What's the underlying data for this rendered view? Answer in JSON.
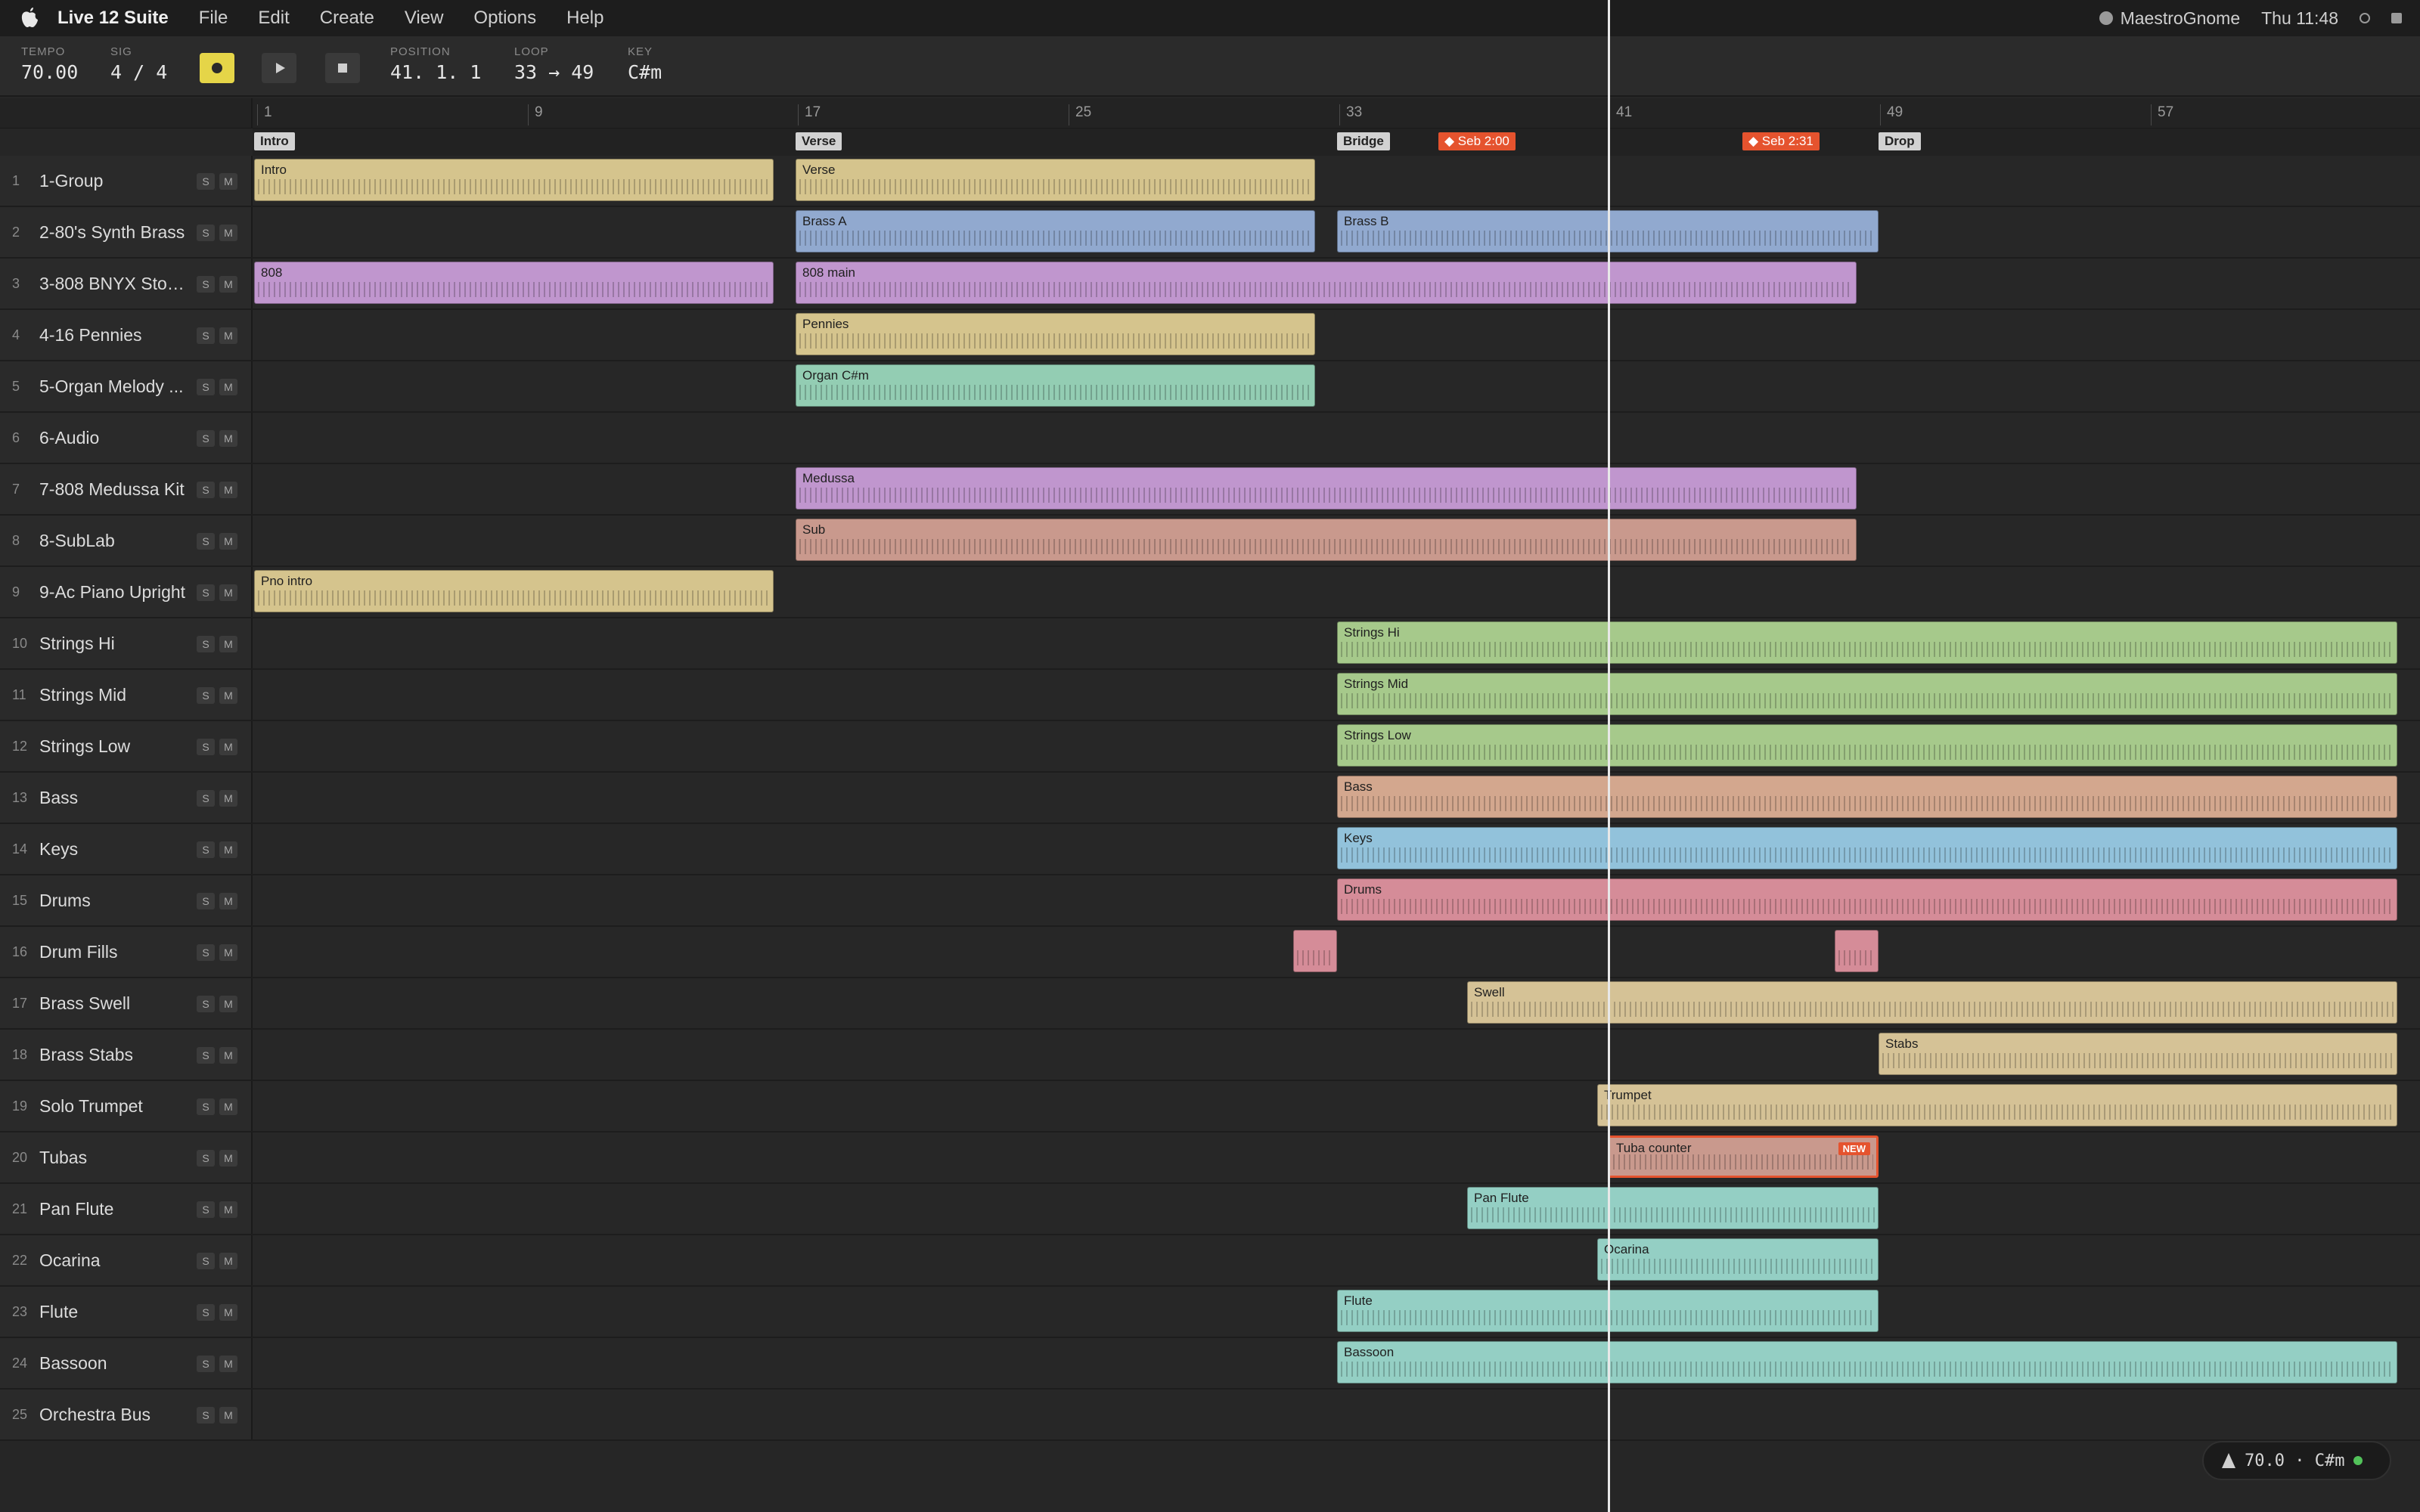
{
  "menubar": {
    "app_name": "Live 12 Suite",
    "items": [
      "File",
      "Edit",
      "Create",
      "View",
      "Options",
      "Help"
    ],
    "user": "MaestroGnome",
    "clock": "Thu 11:48"
  },
  "transport": {
    "tempo_label": "TEMPO",
    "tempo": "70.00",
    "sig_label": "SIG",
    "sig": "4 / 4",
    "position_label": "POSITION",
    "position": "41. 1. 1",
    "loop_label": "LOOP",
    "loop": "33 → 49",
    "key_label": "KEY",
    "key": "C#m"
  },
  "ruler": [
    "1",
    "9",
    "17",
    "25",
    "33",
    "41",
    "49",
    "57"
  ],
  "locators": {
    "sections": [
      "Intro",
      "Verse",
      "Bridge",
      "Drop"
    ],
    "comments": [
      "◆ Seb 2:00",
      "◆ Seb 2:31"
    ]
  },
  "colors": {
    "yellow": "#d5c48d",
    "blue": "#91a9cf",
    "purple": "#c096ce",
    "teal": "#93cdb3",
    "salmon": "#c9998d",
    "green": "#a6c98b",
    "peach": "#d3a78e",
    "sky": "#92c2db",
    "pink": "#d58c98",
    "tan": "#d5c296",
    "aqua": "#94cfc4",
    "accent": "#e5532e"
  },
  "tracks": [
    {
      "num": "1",
      "name": "1-Group",
      "clips": [
        {
          "name": "Intro"
        },
        {
          "name": "Verse"
        }
      ]
    },
    {
      "num": "2",
      "name": "2-80's Synth Brass",
      "clips": [
        {
          "name": "Brass A"
        },
        {
          "name": "Brass B"
        }
      ]
    },
    {
      "num": "3",
      "name": "3-808 BNYX Stop...",
      "clips": [
        {
          "name": "808"
        },
        {
          "name": "808 main"
        }
      ]
    },
    {
      "num": "4",
      "name": "4-16 Pennies",
      "clips": [
        {
          "name": "Pennies"
        }
      ]
    },
    {
      "num": "5",
      "name": "5-Organ Melody ...",
      "clips": [
        {
          "name": "Organ C#m"
        }
      ]
    },
    {
      "num": "6",
      "name": "6-Audio",
      "clips": []
    },
    {
      "num": "7",
      "name": "7-808 Medussa Kit",
      "clips": [
        {
          "name": "Medussa"
        }
      ]
    },
    {
      "num": "8",
      "name": "8-SubLab",
      "clips": [
        {
          "name": "Sub"
        }
      ]
    },
    {
      "num": "9",
      "name": "9-Ac Piano Upright",
      "clips": [
        {
          "name": "Pno intro"
        }
      ]
    },
    {
      "num": "10",
      "name": "Strings Hi",
      "clips": [
        {
          "name": "Strings Hi"
        }
      ]
    },
    {
      "num": "11",
      "name": "Strings Mid",
      "clips": [
        {
          "name": "Strings Mid"
        }
      ]
    },
    {
      "num": "12",
      "name": "Strings Low",
      "clips": [
        {
          "name": "Strings Low"
        }
      ]
    },
    {
      "num": "13",
      "name": "Bass",
      "clips": [
        {
          "name": "Bass"
        }
      ]
    },
    {
      "num": "14",
      "name": "Keys",
      "clips": [
        {
          "name": "Keys"
        }
      ]
    },
    {
      "num": "15",
      "name": "Drums",
      "clips": [
        {
          "name": "Drums"
        }
      ]
    },
    {
      "num": "16",
      "name": "Drum Fills",
      "clips": [
        {
          "name": ""
        },
        {
          "name": ""
        }
      ]
    },
    {
      "num": "17",
      "name": "Brass Swell",
      "clips": [
        {
          "name": "Swell"
        }
      ]
    },
    {
      "num": "18",
      "name": "Brass Stabs",
      "clips": [
        {
          "name": "Stabs"
        }
      ]
    },
    {
      "num": "19",
      "name": "Solo Trumpet",
      "clips": [
        {
          "name": "Trumpet"
        }
      ]
    },
    {
      "num": "20",
      "name": "Tubas",
      "clips": [
        {
          "name": "Tuba counter",
          "badge": "NEW"
        }
      ]
    },
    {
      "num": "21",
      "name": "Pan Flute",
      "clips": [
        {
          "name": "Pan Flute"
        }
      ]
    },
    {
      "num": "22",
      "name": "Ocarina",
      "clips": [
        {
          "name": "Ocarina"
        }
      ]
    },
    {
      "num": "23",
      "name": "Flute",
      "clips": [
        {
          "name": "Flute"
        }
      ]
    },
    {
      "num": "24",
      "name": "Bassoon",
      "clips": [
        {
          "name": "Bassoon"
        }
      ]
    },
    {
      "num": "25",
      "name": "Orchestra Bus",
      "clips": []
    }
  ],
  "solo_label": "S",
  "mute_label": "M",
  "status": {
    "text": "70.0 · C#m"
  }
}
